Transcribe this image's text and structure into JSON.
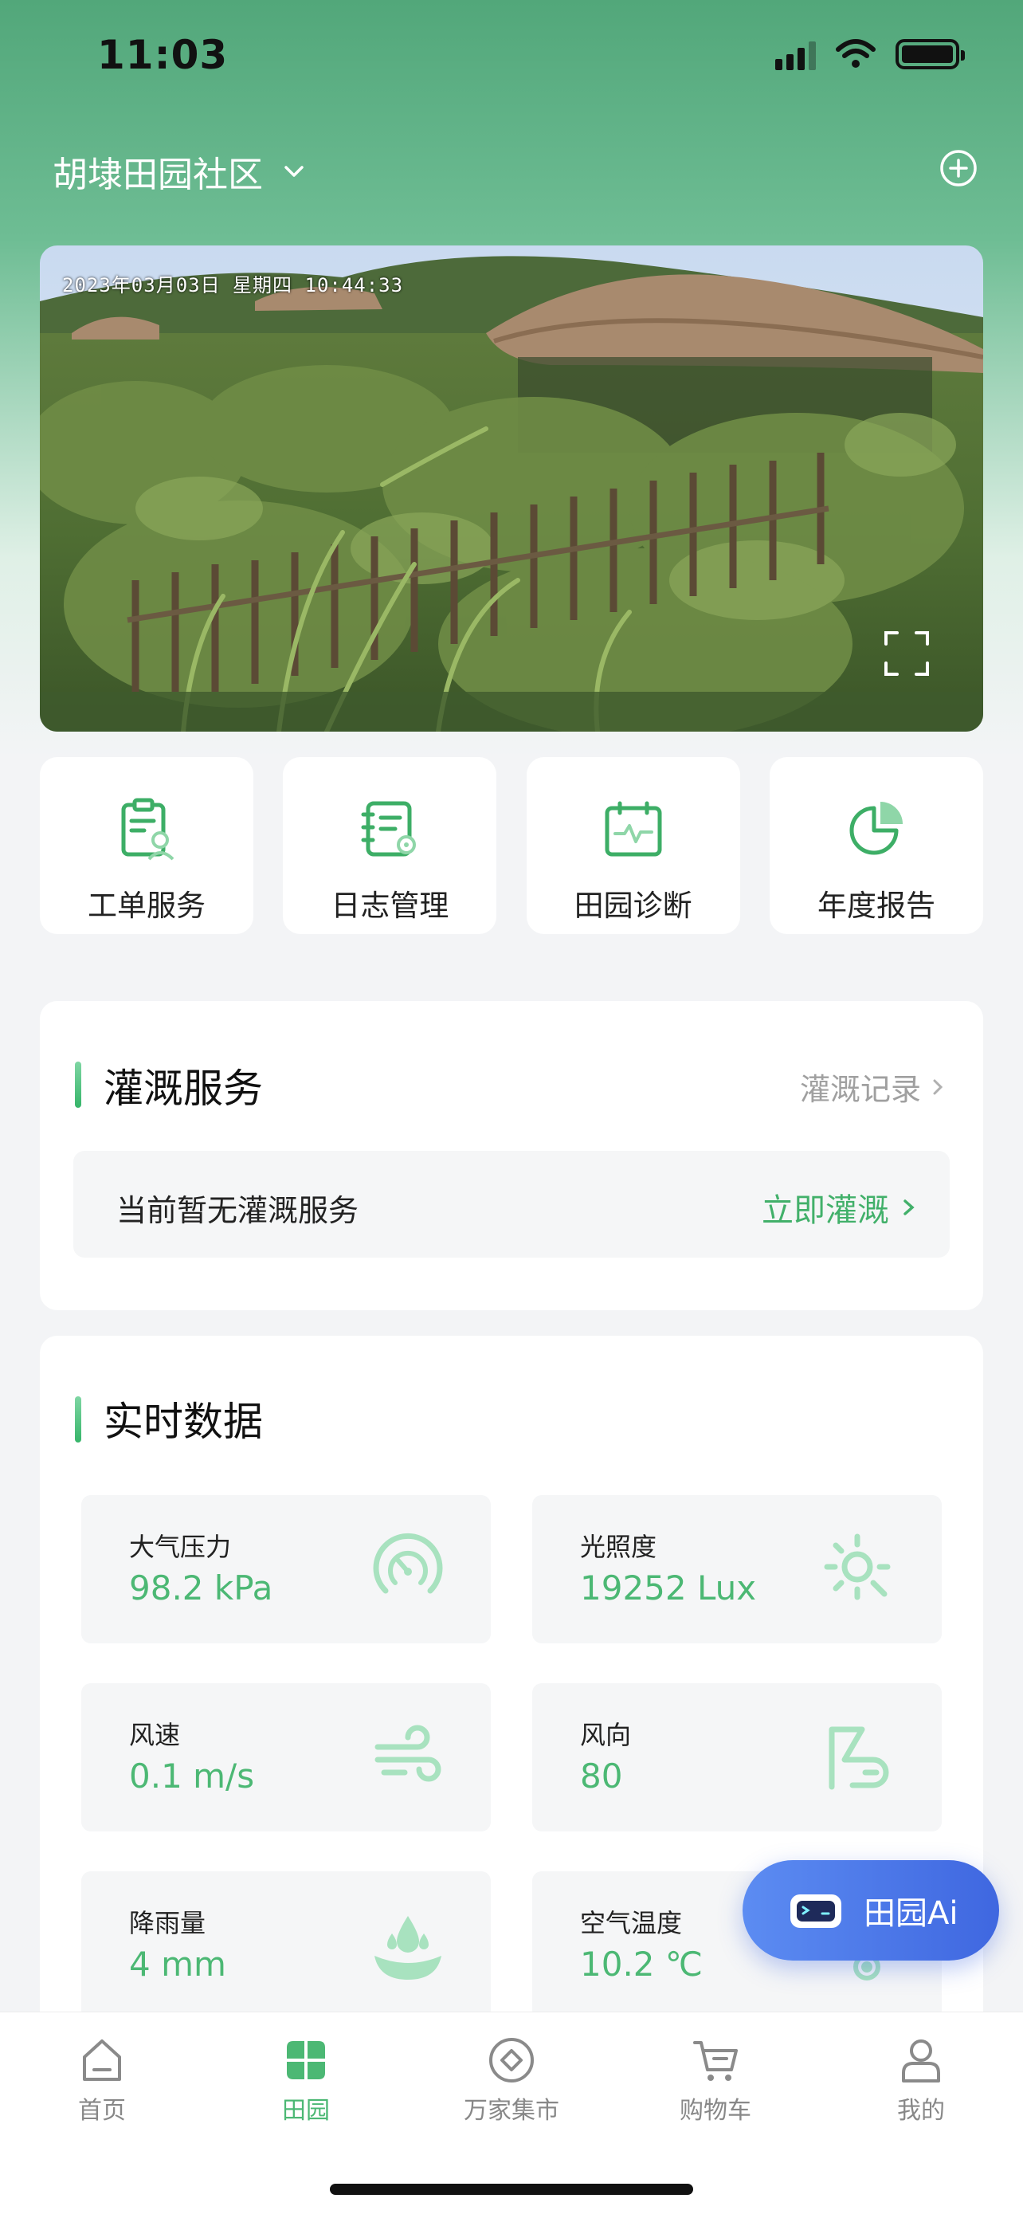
{
  "status_bar": {
    "time": "11:03"
  },
  "header": {
    "community": "胡埭田园社区"
  },
  "camera": {
    "timestamp": "2023年03月03日 星期四 10:44:33"
  },
  "quick_actions": [
    {
      "label": "工单服务",
      "icon": "work-order-icon"
    },
    {
      "label": "日志管理",
      "icon": "log-management-icon"
    },
    {
      "label": "田园诊断",
      "icon": "diagnosis-icon"
    },
    {
      "label": "年度报告",
      "icon": "annual-report-icon"
    }
  ],
  "irrigation": {
    "title": "灌溉服务",
    "record_link": "灌溉记录",
    "empty_text": "当前暂无灌溉服务",
    "action": "立即灌溉"
  },
  "realtime": {
    "title": "实时数据",
    "metrics": [
      {
        "label": "大气压力",
        "value": "98.2 kPa",
        "icon": "gauge-icon"
      },
      {
        "label": "光照度",
        "value": "19252 Lux",
        "icon": "sun-icon"
      },
      {
        "label": "风速",
        "value": "0.1 m/s",
        "icon": "wind-icon"
      },
      {
        "label": "风向",
        "value": "80",
        "icon": "wind-direction-icon"
      },
      {
        "label": "降雨量",
        "value": "4 mm",
        "icon": "rain-drop-icon"
      },
      {
        "label": "空气温度",
        "value": "10.2 ℃",
        "icon": "thermometer-icon"
      }
    ]
  },
  "ai_assistant": {
    "label": "田园Ai"
  },
  "tabbar": {
    "items": [
      {
        "label": "首页",
        "icon": "home-icon"
      },
      {
        "label": "田园",
        "icon": "garden-icon",
        "active": true
      },
      {
        "label": "万家集市",
        "icon": "market-icon"
      },
      {
        "label": "购物车",
        "icon": "cart-icon"
      },
      {
        "label": "我的",
        "icon": "profile-icon"
      }
    ]
  },
  "colors": {
    "brand_green": "#4cb874",
    "header_green": "#52a77a",
    "ai_blue": "#4a75e8"
  }
}
